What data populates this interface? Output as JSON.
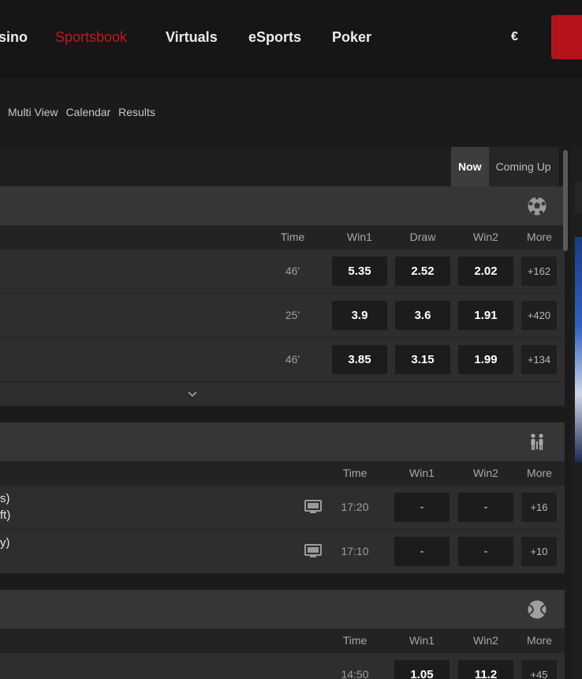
{
  "nav": {
    "items": [
      {
        "label": "sino",
        "active": false
      },
      {
        "label": "Sportsbook",
        "active": true
      },
      {
        "label": "Virtuals",
        "active": false
      },
      {
        "label": "eSports",
        "active": false
      },
      {
        "label": "Poker",
        "active": false
      }
    ],
    "currency": "€"
  },
  "subnav": [
    "Multi View",
    "Calendar",
    "Results"
  ],
  "tabs": [
    {
      "label": "Now",
      "active": true
    },
    {
      "label": "Coming Up",
      "active": false
    }
  ],
  "sections": [
    {
      "sport_icon": "soccer-ball-icon",
      "columns": [
        "Time",
        "Win1",
        "Draw",
        "Win2",
        "More"
      ],
      "rows": [
        {
          "time": "46'",
          "odds": [
            "5.35",
            "2.52",
            "2.02"
          ],
          "more": "+162"
        },
        {
          "time": "25'",
          "odds": [
            "3.9",
            "3.6",
            "1.91"
          ],
          "more": "+420"
        },
        {
          "time": "46'",
          "odds": [
            "3.85",
            "3.15",
            "1.99"
          ],
          "more": "+134"
        }
      ]
    },
    {
      "sport_icon": "table-tennis-icon",
      "columns": [
        "Time",
        "Win1",
        "Win2",
        "More"
      ],
      "rows": [
        {
          "team_line1": "s)",
          "team_line2": "ft)",
          "time": "17:20",
          "odds": [
            "-",
            "-"
          ],
          "more": "+16"
        },
        {
          "team_line1": "y)",
          "team_line2": "",
          "time": "17:10",
          "odds": [
            "-",
            "-"
          ],
          "more": "+10"
        }
      ]
    },
    {
      "sport_icon": "tennis-ball-icon",
      "columns": [
        "Time",
        "Win1",
        "Win2",
        "More"
      ],
      "rows": [
        {
          "time": "14:50",
          "odds": [
            "1.05",
            "11.2"
          ],
          "more": "+45"
        }
      ]
    }
  ],
  "colors": {
    "accent": "#c0191f",
    "background": "#1b1b1b",
    "panel": "#2e2e2e"
  }
}
